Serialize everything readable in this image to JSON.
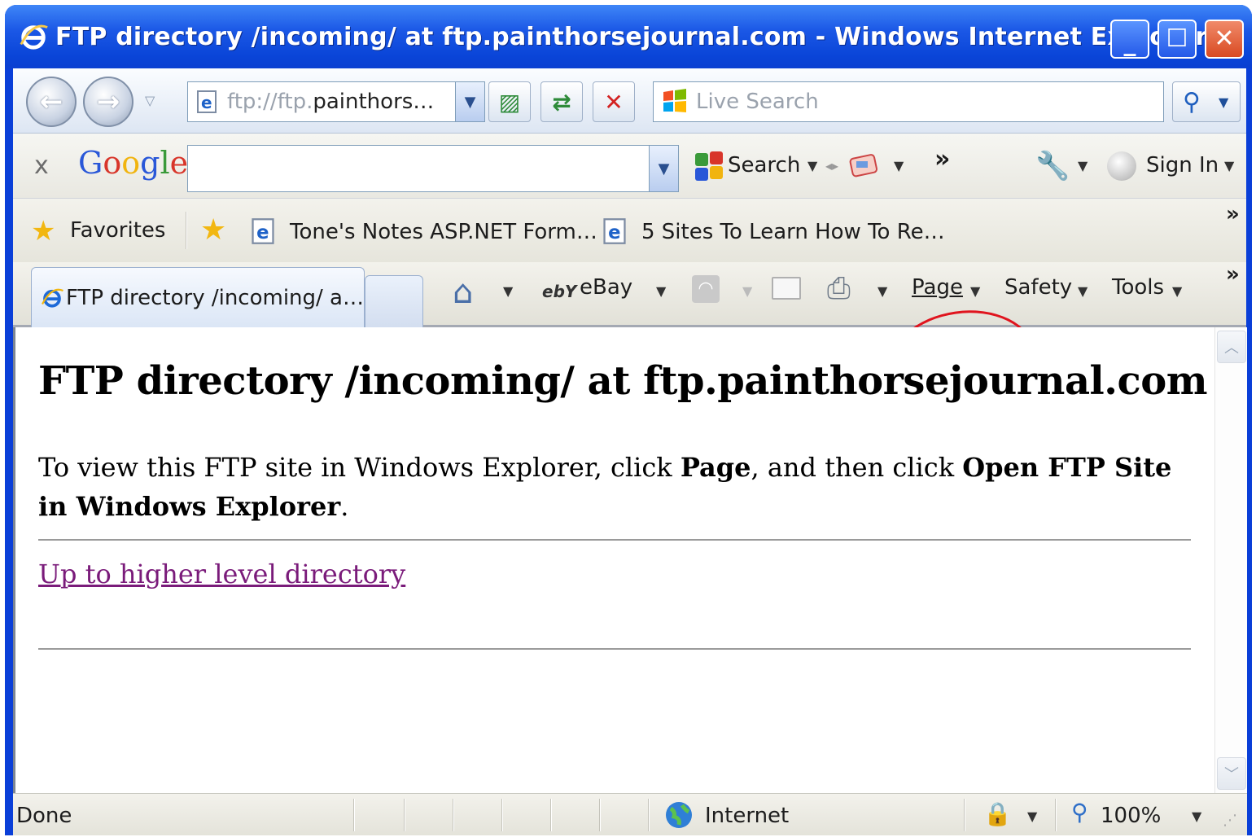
{
  "window": {
    "title": "FTP directory /incoming/ at ftp.painthorsejournal.com - Windows Internet Explorer",
    "buttons": {
      "minimize": "_",
      "maximize": "☐",
      "close": "✕"
    }
  },
  "address_bar": {
    "url_prefix": "ftp://ftp.",
    "url_main": "painthors…",
    "search_placeholder": "Live Search"
  },
  "google_toolbar": {
    "close": "x",
    "logo": "Google",
    "search_label": "Search",
    "more": "»",
    "sign_in": "Sign In"
  },
  "favorites_bar": {
    "favorites_label": "Favorites",
    "links": [
      "Tone's Notes ASP.NET Form…",
      "5 Sites To Learn How To Re…"
    ],
    "more": "»"
  },
  "command_bar": {
    "tab_title": "FTP directory /incoming/ a…",
    "ebay": "eBay",
    "page_label": "Page",
    "safety_label": "Safety",
    "tools_label": "Tools",
    "more": "»"
  },
  "content": {
    "heading": "FTP directory /incoming/ at ftp.painthorsejournal.com",
    "para_1": "To view this FTP site in Windows Explorer, click ",
    "para_bold_1": "Page",
    "para_2": ", and then click ",
    "para_bold_2": "Open FTP Site in Windows Explorer",
    "para_3": ".",
    "link": "Up to higher level directory"
  },
  "status_bar": {
    "status": "Done",
    "zone": "Internet",
    "zoom": "100%"
  },
  "colors": {
    "title_blue": "#0a45d8",
    "link_visited": "#7a1b7a",
    "annotation_red": "#e0141e"
  }
}
